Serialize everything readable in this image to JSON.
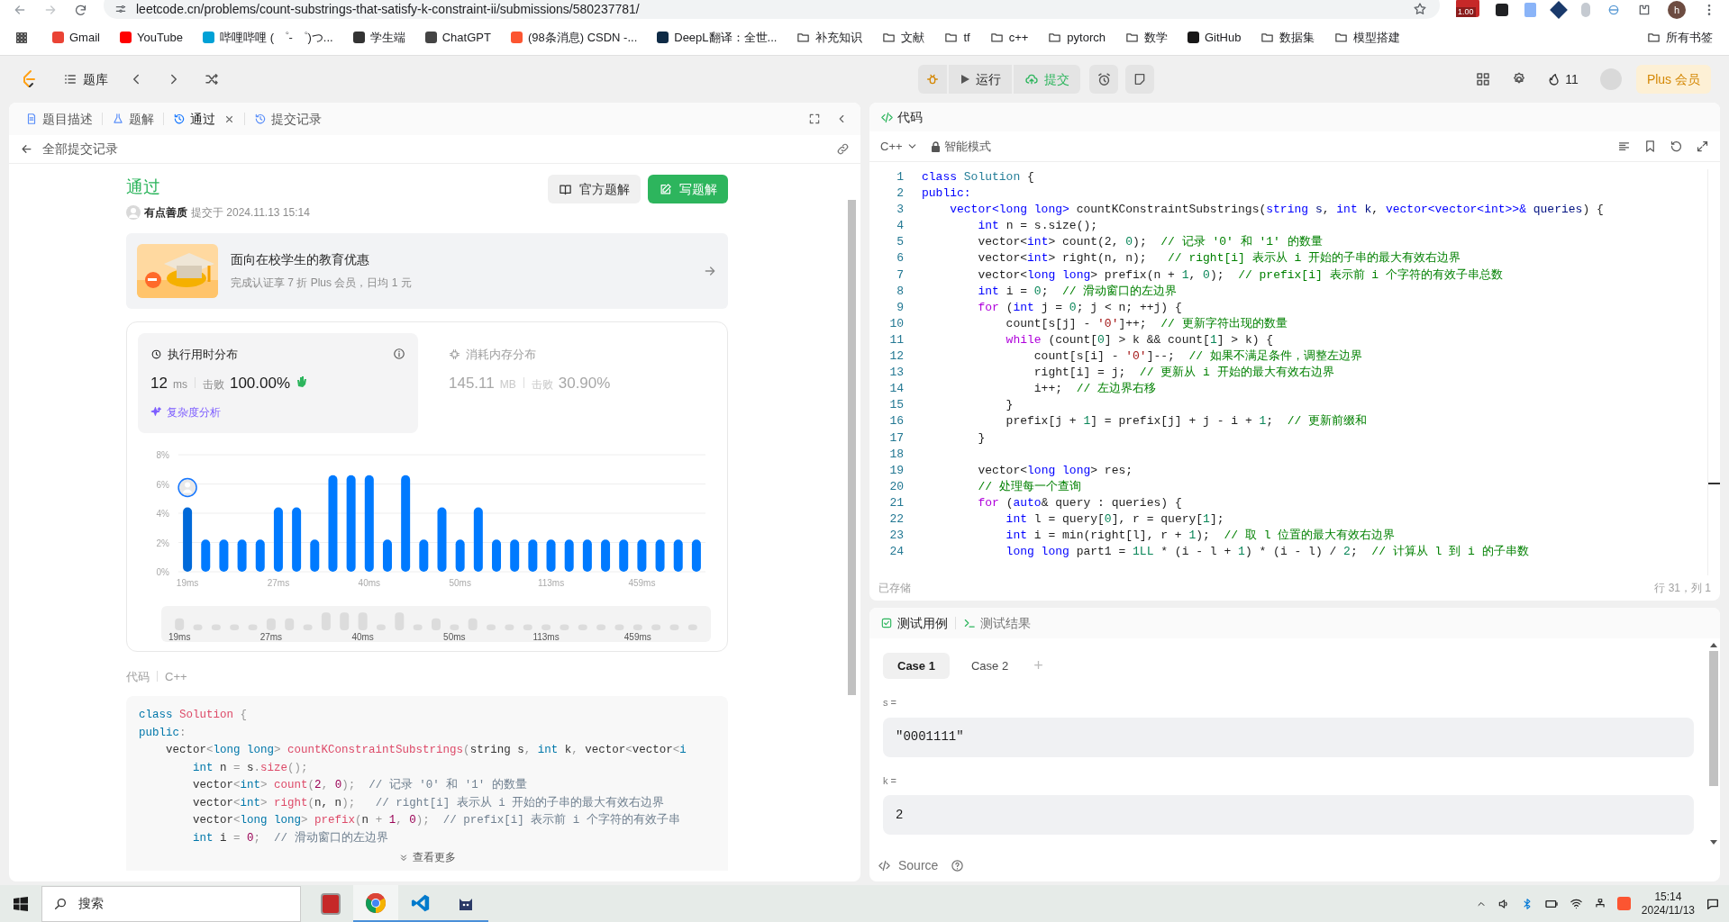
{
  "browser": {
    "url": "leetcode.cn/problems/count-substrings-that-satisfy-k-constraint-ii/submissions/580237781/",
    "extension_badge": "1.00",
    "profile": "h",
    "bookmarks": [
      {
        "kind": "site",
        "label": "Gmail",
        "color": "#ea4335"
      },
      {
        "kind": "site",
        "label": "YouTube",
        "color": "#ff0000"
      },
      {
        "kind": "site",
        "label": "哔哩哔哩 ( ゜- ゜)つ...",
        "color": "#00a1d6"
      },
      {
        "kind": "site",
        "label": "学生端",
        "color": "#333333"
      },
      {
        "kind": "site",
        "label": "ChatGPT",
        "color": "#444444"
      },
      {
        "kind": "site",
        "label": "(98条消息) CSDN -...",
        "color": "#fc5531"
      },
      {
        "kind": "site",
        "label": "DeepL翻译：全世...",
        "color": "#0f2b46"
      },
      {
        "kind": "folder",
        "label": "补充知识"
      },
      {
        "kind": "folder",
        "label": "文献"
      },
      {
        "kind": "folder",
        "label": "tf"
      },
      {
        "kind": "folder",
        "label": "c++"
      },
      {
        "kind": "folder",
        "label": "pytorch"
      },
      {
        "kind": "folder",
        "label": "数学"
      },
      {
        "kind": "site",
        "label": "GitHub",
        "color": "#181717"
      },
      {
        "kind": "folder",
        "label": "数据集"
      },
      {
        "kind": "folder",
        "label": "模型搭建"
      }
    ],
    "all_bookmarks": "所有书签"
  },
  "nav": {
    "problem_list": "题库",
    "run": "运行",
    "submit": "提交",
    "streak": "11",
    "plus": "Plus 会员"
  },
  "left_tabs": [
    {
      "label": "题目描述",
      "selected": false,
      "closable": false
    },
    {
      "label": "题解",
      "selected": false,
      "closable": false
    },
    {
      "label": "通过",
      "selected": true,
      "closable": true
    },
    {
      "label": "提交记录",
      "selected": false,
      "closable": false
    }
  ],
  "back_link": "全部提交记录",
  "submission": {
    "status": "通过",
    "user": "有点善质",
    "submitted_at": "提交于 2024.11.13 15:14",
    "official_button": "官方题解",
    "write_button": "写题解"
  },
  "banner": {
    "title": "面向在校学生的教育优惠",
    "subtitle": "完成认证享 7 折 Plus 会员，日均 1 元"
  },
  "stats": {
    "metrics": [
      {
        "title": "执行用时分布",
        "value": "12",
        "unit": "ms",
        "beat_label": "击败",
        "beat": "100.00%",
        "selected": true
      },
      {
        "title": "消耗内存分布",
        "value": "145.11",
        "unit": "MB",
        "beat_label": "击败",
        "beat": "30.90%",
        "selected": false
      }
    ],
    "analysis_link": "复杂度分析",
    "chart_data": {
      "type": "bar",
      "categories": [
        "19ms",
        null,
        null,
        null,
        null,
        "27ms",
        null,
        null,
        null,
        null,
        "40ms",
        null,
        null,
        null,
        null,
        "50ms",
        null,
        null,
        null,
        null,
        "113ms",
        null,
        null,
        null,
        null,
        "459ms",
        null,
        null,
        null
      ],
      "values": [
        4.4,
        2.2,
        2.2,
        2.2,
        2.2,
        4.4,
        4.4,
        2.2,
        6.6,
        6.6,
        6.6,
        2.2,
        6.6,
        2.2,
        4.4,
        2.2,
        4.4,
        2.2,
        2.2,
        2.2,
        2.2,
        2.2,
        2.2,
        2.2,
        2.2,
        2.2,
        2.2,
        2.2,
        2.2
      ],
      "ylim": [
        0,
        8
      ],
      "grid": true,
      "yticks": [
        {
          "value": 0,
          "label": "0%"
        },
        {
          "value": 2,
          "label": "2%"
        },
        {
          "value": 4,
          "label": "4%"
        },
        {
          "value": 6,
          "label": "6%"
        },
        {
          "value": 8,
          "label": "8%"
        }
      ]
    },
    "overview_labels": [
      "19ms",
      "27ms",
      "40ms",
      "50ms",
      "113ms",
      "459ms"
    ]
  },
  "code_section": {
    "label": "代码",
    "language": "C++",
    "more": "查看更多",
    "lines": [
      [
        {
          "kind": "k",
          "text": "class"
        },
        {
          "kind": "f",
          "text": " Solution"
        },
        {
          "kind": "o",
          "text": " {"
        }
      ],
      [
        {
          "kind": "k",
          "text": "public"
        },
        {
          "kind": "o",
          "text": ":"
        }
      ],
      [
        {
          "kind": "p",
          "text": "    vector"
        },
        {
          "kind": "o",
          "text": "<"
        },
        {
          "kind": "k",
          "text": "long long"
        },
        {
          "kind": "o",
          "text": "> "
        },
        {
          "kind": "f",
          "text": "countKConstraintSubstrings"
        },
        {
          "kind": "o",
          "text": "("
        },
        {
          "kind": "p",
          "text": "string s"
        },
        {
          "kind": "o",
          "text": ", "
        },
        {
          "kind": "k",
          "text": "int"
        },
        {
          "kind": "p",
          "text": " k"
        },
        {
          "kind": "o",
          "text": ", "
        },
        {
          "kind": "p",
          "text": "vector"
        },
        {
          "kind": "o",
          "text": "<"
        },
        {
          "kind": "p",
          "text": "vector"
        },
        {
          "kind": "o",
          "text": "<"
        },
        {
          "kind": "k",
          "text": "i"
        }
      ],
      [
        {
          "kind": "k",
          "text": "        int"
        },
        {
          "kind": "p",
          "text": " n "
        },
        {
          "kind": "o",
          "text": "="
        },
        {
          "kind": "p",
          "text": " s"
        },
        {
          "kind": "o",
          "text": "."
        },
        {
          "kind": "f",
          "text": "size"
        },
        {
          "kind": "o",
          "text": "();"
        }
      ],
      [
        {
          "kind": "p",
          "text": "        vector"
        },
        {
          "kind": "o",
          "text": "<"
        },
        {
          "kind": "k",
          "text": "int"
        },
        {
          "kind": "o",
          "text": "> "
        },
        {
          "kind": "f",
          "text": "count"
        },
        {
          "kind": "o",
          "text": "("
        },
        {
          "kind": "n",
          "text": "2"
        },
        {
          "kind": "o",
          "text": ", "
        },
        {
          "kind": "n",
          "text": "0"
        },
        {
          "kind": "o",
          "text": ");  "
        },
        {
          "kind": "m",
          "text": "// 记录 '0' 和 '1' 的数量"
        }
      ],
      [
        {
          "kind": "p",
          "text": "        vector"
        },
        {
          "kind": "o",
          "text": "<"
        },
        {
          "kind": "k",
          "text": "int"
        },
        {
          "kind": "o",
          "text": "> "
        },
        {
          "kind": "f",
          "text": "right"
        },
        {
          "kind": "o",
          "text": "("
        },
        {
          "kind": "p",
          "text": "n, n"
        },
        {
          "kind": "o",
          "text": ");   "
        },
        {
          "kind": "m",
          "text": "// right[i] 表示从 i 开始的子串的最大有效右边界"
        }
      ],
      [
        {
          "kind": "p",
          "text": "        vector"
        },
        {
          "kind": "o",
          "text": "<"
        },
        {
          "kind": "k",
          "text": "long long"
        },
        {
          "kind": "o",
          "text": "> "
        },
        {
          "kind": "f",
          "text": "prefix"
        },
        {
          "kind": "o",
          "text": "("
        },
        {
          "kind": "p",
          "text": "n "
        },
        {
          "kind": "o",
          "text": "+ "
        },
        {
          "kind": "n",
          "text": "1"
        },
        {
          "kind": "o",
          "text": ", "
        },
        {
          "kind": "n",
          "text": "0"
        },
        {
          "kind": "o",
          "text": ");  "
        },
        {
          "kind": "m",
          "text": "// prefix[i] 表示前 i 个字符的有效子串"
        }
      ],
      [
        {
          "kind": "k",
          "text": "        int"
        },
        {
          "kind": "p",
          "text": " i "
        },
        {
          "kind": "o",
          "text": "= "
        },
        {
          "kind": "n",
          "text": "0"
        },
        {
          "kind": "o",
          "text": ";  "
        },
        {
          "kind": "m",
          "text": "// 滑动窗口的左边界"
        }
      ]
    ]
  },
  "editor": {
    "title": "代码",
    "language": "C++",
    "mode": "智能模式",
    "saved": "已存储",
    "cursor": "行 31，列 1",
    "lines": [
      {
        "no": "1",
        "code": [
          {
            "kind": "k",
            "text": "class"
          },
          {
            "kind": "t",
            "text": " Solution"
          },
          {
            "kind": "p",
            "text": " {"
          }
        ]
      },
      {
        "no": "2",
        "code": [
          {
            "kind": "k",
            "text": "public:"
          }
        ]
      },
      {
        "no": "3",
        "code": [
          {
            "kind": "k",
            "text": "    vector<long long>"
          },
          {
            "kind": "p",
            "text": " countKConstraintSubstrings("
          },
          {
            "kind": "k",
            "text": "string"
          },
          {
            "kind": "v",
            "text": " s"
          },
          {
            "kind": "p",
            "text": ", "
          },
          {
            "kind": "k",
            "text": "int"
          },
          {
            "kind": "v",
            "text": " k"
          },
          {
            "kind": "p",
            "text": ", "
          },
          {
            "kind": "k",
            "text": "vector<vector<int>>&"
          },
          {
            "kind": "v",
            "text": " queries"
          },
          {
            "kind": "p",
            "text": ") {"
          }
        ]
      },
      {
        "no": "4",
        "code": [
          {
            "kind": "k",
            "text": "        int"
          },
          {
            "kind": "p",
            "text": " n = s.size();"
          }
        ]
      },
      {
        "no": "5",
        "code": [
          {
            "kind": "p",
            "text": "        vector<"
          },
          {
            "kind": "k",
            "text": "int"
          },
          {
            "kind": "p",
            "text": "> count(2, "
          },
          {
            "kind": "n",
            "text": "0"
          },
          {
            "kind": "p",
            "text": ");  "
          },
          {
            "kind": "m",
            "text": "// 记录 '0' 和 '1' 的数量"
          }
        ]
      },
      {
        "no": "6",
        "code": [
          {
            "kind": "p",
            "text": "        vector<"
          },
          {
            "kind": "k",
            "text": "int"
          },
          {
            "kind": "p",
            "text": "> right(n, n);   "
          },
          {
            "kind": "m",
            "text": "// right[i] 表示从 i 开始的子串的最大有效右边界"
          }
        ]
      },
      {
        "no": "7",
        "code": [
          {
            "kind": "p",
            "text": "        vector<"
          },
          {
            "kind": "k",
            "text": "long long"
          },
          {
            "kind": "p",
            "text": "> prefix(n + "
          },
          {
            "kind": "n",
            "text": "1"
          },
          {
            "kind": "p",
            "text": ", "
          },
          {
            "kind": "n",
            "text": "0"
          },
          {
            "kind": "p",
            "text": ");  "
          },
          {
            "kind": "m",
            "text": "// prefix[i] 表示前 i 个字符的有效子串总数"
          }
        ]
      },
      {
        "no": "8",
        "code": [
          {
            "kind": "k",
            "text": "        int"
          },
          {
            "kind": "p",
            "text": " i = "
          },
          {
            "kind": "n",
            "text": "0"
          },
          {
            "kind": "p",
            "text": ";  "
          },
          {
            "kind": "m",
            "text": "// 滑动窗口的左边界"
          }
        ]
      },
      {
        "no": "9",
        "code": [
          {
            "kind": "c",
            "text": "        for"
          },
          {
            "kind": "p",
            "text": " ("
          },
          {
            "kind": "k",
            "text": "int"
          },
          {
            "kind": "p",
            "text": " j = "
          },
          {
            "kind": "n",
            "text": "0"
          },
          {
            "kind": "p",
            "text": "; j < n; ++j) {"
          }
        ]
      },
      {
        "no": "10",
        "code": [
          {
            "kind": "p",
            "text": "            count[s[j] - "
          },
          {
            "kind": "s",
            "text": "'0'"
          },
          {
            "kind": "p",
            "text": "]++;  "
          },
          {
            "kind": "m",
            "text": "// 更新字符出现的数量"
          }
        ]
      },
      {
        "no": "11",
        "code": [
          {
            "kind": "c",
            "text": "            while"
          },
          {
            "kind": "p",
            "text": " (count["
          },
          {
            "kind": "n",
            "text": "0"
          },
          {
            "kind": "p",
            "text": "] > k && count["
          },
          {
            "kind": "n",
            "text": "1"
          },
          {
            "kind": "p",
            "text": "] > k) {"
          }
        ]
      },
      {
        "no": "12",
        "code": [
          {
            "kind": "p",
            "text": "                count[s[i] - "
          },
          {
            "kind": "s",
            "text": "'0'"
          },
          {
            "kind": "p",
            "text": "]--;  "
          },
          {
            "kind": "m",
            "text": "// 如果不满足条件，调整左边界"
          }
        ]
      },
      {
        "no": "13",
        "code": [
          {
            "kind": "p",
            "text": "                right[i] = j;  "
          },
          {
            "kind": "m",
            "text": "// 更新从 i 开始的最大有效右边界"
          }
        ]
      },
      {
        "no": "14",
        "code": [
          {
            "kind": "p",
            "text": "                i++;  "
          },
          {
            "kind": "m",
            "text": "// 左边界右移"
          }
        ]
      },
      {
        "no": "15",
        "code": [
          {
            "kind": "p",
            "text": "            }"
          }
        ]
      },
      {
        "no": "16",
        "code": [
          {
            "kind": "p",
            "text": "            prefix[j + "
          },
          {
            "kind": "n",
            "text": "1"
          },
          {
            "kind": "p",
            "text": "] = prefix[j] + j - i + "
          },
          {
            "kind": "n",
            "text": "1"
          },
          {
            "kind": "p",
            "text": ";  "
          },
          {
            "kind": "m",
            "text": "// 更新前缀和"
          }
        ]
      },
      {
        "no": "17",
        "code": [
          {
            "kind": "p",
            "text": "        }"
          }
        ]
      },
      {
        "no": "18"
      },
      {
        "no": "19",
        "code": [
          {
            "kind": "p",
            "text": "        vector<"
          },
          {
            "kind": "k",
            "text": "long long"
          },
          {
            "kind": "p",
            "text": "> res;"
          }
        ]
      },
      {
        "no": "20",
        "code": [
          {
            "kind": "m",
            "text": "        // 处理每一个查询"
          }
        ]
      },
      {
        "no": "21",
        "code": [
          {
            "kind": "c",
            "text": "        for"
          },
          {
            "kind": "p",
            "text": " ("
          },
          {
            "kind": "k",
            "text": "auto"
          },
          {
            "kind": "p",
            "text": "& query : queries) {"
          }
        ]
      },
      {
        "no": "22",
        "code": [
          {
            "kind": "k",
            "text": "            int"
          },
          {
            "kind": "p",
            "text": " l = query["
          },
          {
            "kind": "n",
            "text": "0"
          },
          {
            "kind": "p",
            "text": "], r = query["
          },
          {
            "kind": "n",
            "text": "1"
          },
          {
            "kind": "p",
            "text": "];"
          }
        ]
      },
      {
        "no": "23",
        "code": [
          {
            "kind": "k",
            "text": "            int"
          },
          {
            "kind": "p",
            "text": " i = min(right[l], r + "
          },
          {
            "kind": "n",
            "text": "1"
          },
          {
            "kind": "p",
            "text": ");  "
          },
          {
            "kind": "m",
            "text": "// 取 l 位置的最大有效右边界"
          }
        ]
      },
      {
        "no": "24",
        "code": [
          {
            "kind": "k",
            "text": "            long long"
          },
          {
            "kind": "p",
            "text": " part1 = "
          },
          {
            "kind": "n",
            "text": "1LL"
          },
          {
            "kind": "p",
            "text": " * (i - l + "
          },
          {
            "kind": "n",
            "text": "1"
          },
          {
            "kind": "p",
            "text": ") * (i - l) / "
          },
          {
            "kind": "n",
            "text": "2"
          },
          {
            "kind": "p",
            "text": ";  "
          },
          {
            "kind": "m",
            "text": "// 计算从 l 到 i 的子串数"
          }
        ]
      }
    ]
  },
  "test_panel": {
    "tabs": [
      {
        "label": "测试用例",
        "selected": true
      },
      {
        "label": "测试结果",
        "selected": false
      }
    ],
    "cases": [
      {
        "label": "Case 1",
        "selected": true
      },
      {
        "label": "Case 2",
        "selected": false
      }
    ],
    "add": "+",
    "params": [
      {
        "label": "s =",
        "value": "\"0001111\""
      },
      {
        "label": "k =",
        "value": "2"
      }
    ],
    "source": "Source"
  },
  "taskbar": {
    "search_placeholder": "搜索",
    "time": "15:14",
    "date": "2024/11/13"
  }
}
